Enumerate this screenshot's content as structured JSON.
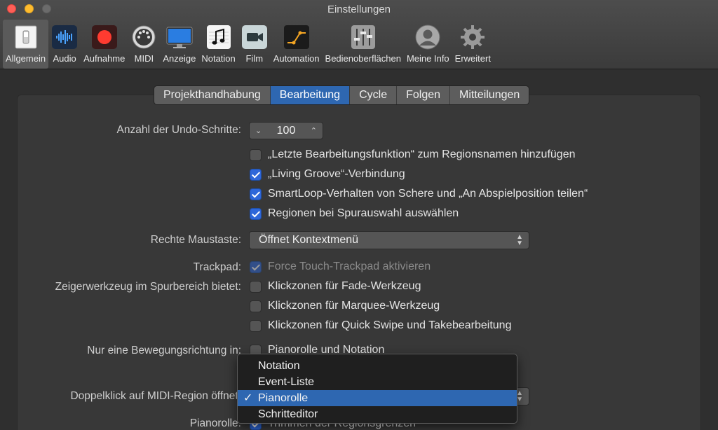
{
  "window": {
    "title": "Einstellungen"
  },
  "toolbar": {
    "items": [
      {
        "label": "Allgemein",
        "icon": "switch-icon",
        "active": true
      },
      {
        "label": "Audio",
        "icon": "waveform-icon"
      },
      {
        "label": "Aufnahme",
        "icon": "record-icon"
      },
      {
        "label": "MIDI",
        "icon": "midi-connector-icon"
      },
      {
        "label": "Anzeige",
        "icon": "display-icon"
      },
      {
        "label": "Notation",
        "icon": "music-note-icon"
      },
      {
        "label": "Film",
        "icon": "video-camera-icon"
      },
      {
        "label": "Automation",
        "icon": "automation-curve-icon"
      },
      {
        "label": "Bedienoberflächen",
        "icon": "faders-icon"
      },
      {
        "label": "Meine Info",
        "icon": "user-silhouette-icon"
      },
      {
        "label": "Erweitert",
        "icon": "gear-icon"
      }
    ]
  },
  "tabs": [
    "Projekthandhabung",
    "Bearbeitung",
    "Cycle",
    "Folgen",
    "Mitteilungen"
  ],
  "active_tab": "Bearbeitung",
  "settings": {
    "undo_label": "Anzahl der Undo-Schritte:",
    "undo_value": "100",
    "checks1": [
      {
        "text": "„Letzte Bearbeitungsfunktion“ zum Regionsnamen hinzufügen",
        "checked": false
      },
      {
        "text": "„Living Groove“-Verbindung",
        "checked": true
      },
      {
        "text": "SmartLoop-Verhalten von Schere und „An Abspielposition teilen“",
        "checked": true
      },
      {
        "text": "Regionen bei Spurauswahl auswählen",
        "checked": true
      }
    ],
    "right_mouse_label": "Rechte Maustaste:",
    "right_mouse_value": "Öffnet Kontextmenü",
    "trackpad_label": "Trackpad:",
    "trackpad_text": "Force Touch-Trackpad aktivieren",
    "pointer_label": "Zeigerwerkzeug im Spurbereich bietet:",
    "pointer_checks": [
      {
        "text": "Klickzonen für Fade-Werkzeug",
        "checked": false
      },
      {
        "text": "Klickzonen für Marquee-Werkzeug",
        "checked": false
      },
      {
        "text": "Klickzonen für Quick Swipe und Takebearbeitung",
        "checked": false
      }
    ],
    "direction_label": "Nur eine Bewegungsrichtung in:",
    "direction_text": "Pianorolle und Notation",
    "doubleclick_label": "Doppelklick auf MIDI-Region öffnet:",
    "pianoroll_label": "Pianorolle:",
    "pianoroll_text": "Trimmen der Regionsgrenzen"
  },
  "menu": {
    "items": [
      "Notation",
      "Event-Liste",
      "Pianorolle",
      "Schritteditor"
    ],
    "selected": "Pianorolle",
    "check_glyph": "✓"
  },
  "colors": {
    "accent": "#2e67b1",
    "record": "#ff3b30",
    "close": "#ff5f57",
    "minimize": "#febc2e"
  }
}
